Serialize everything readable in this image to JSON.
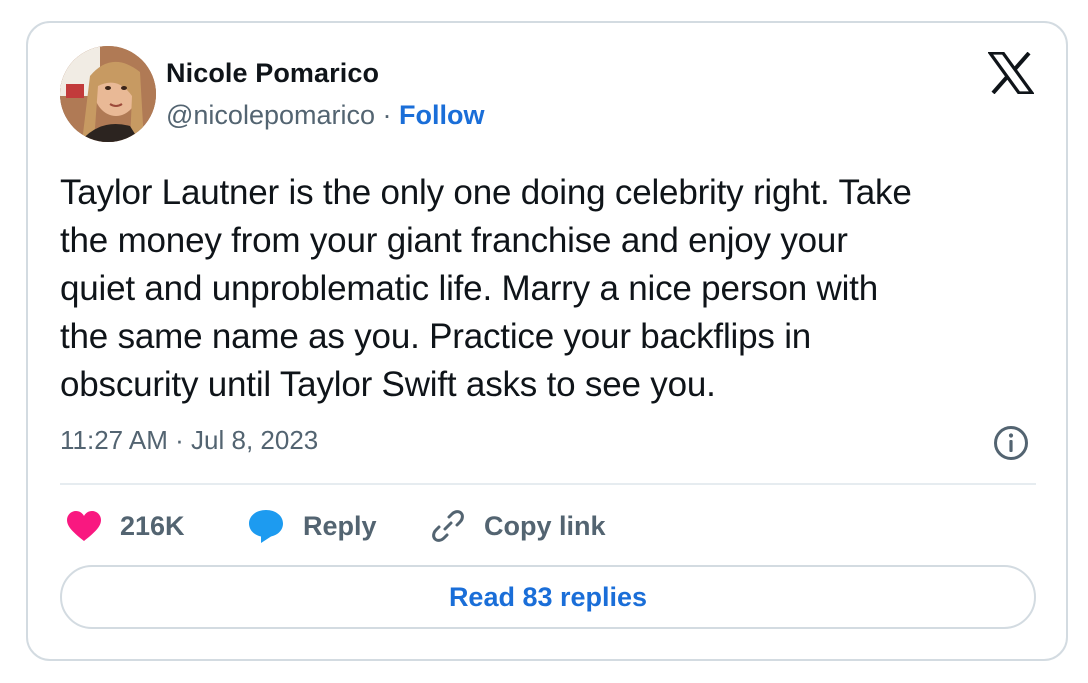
{
  "author": {
    "display_name": "Nicole Pomarico",
    "handle": "@nicolepomarico",
    "separator": "·",
    "follow_label": "Follow"
  },
  "tweet": {
    "text": "Taylor Lautner is the only one doing celebrity right. Take\nthe money from your giant franchise and enjoy your\nquiet and unproblematic life. Marry a nice person with\nthe same name as you. Practice your backflips in\nobscurity until Taylor Swift asks to see you.",
    "timestamp": "11:27 AM · Jul 8, 2023"
  },
  "actions": {
    "like_count": "216K",
    "reply_label": "Reply",
    "copy_link_label": "Copy link"
  },
  "footer": {
    "read_replies_label": "Read 83 replies"
  },
  "icons": {
    "logo": "x-logo-icon",
    "info": "info-icon",
    "like": "heart-icon",
    "reply": "speech-bubble-icon",
    "copy": "link-icon"
  },
  "colors": {
    "text": "#0f1419",
    "secondary": "#536471",
    "link": "#1a6ed8",
    "like": "#f91880",
    "reply": "#1d9bf0",
    "border": "#d3dbe1"
  }
}
